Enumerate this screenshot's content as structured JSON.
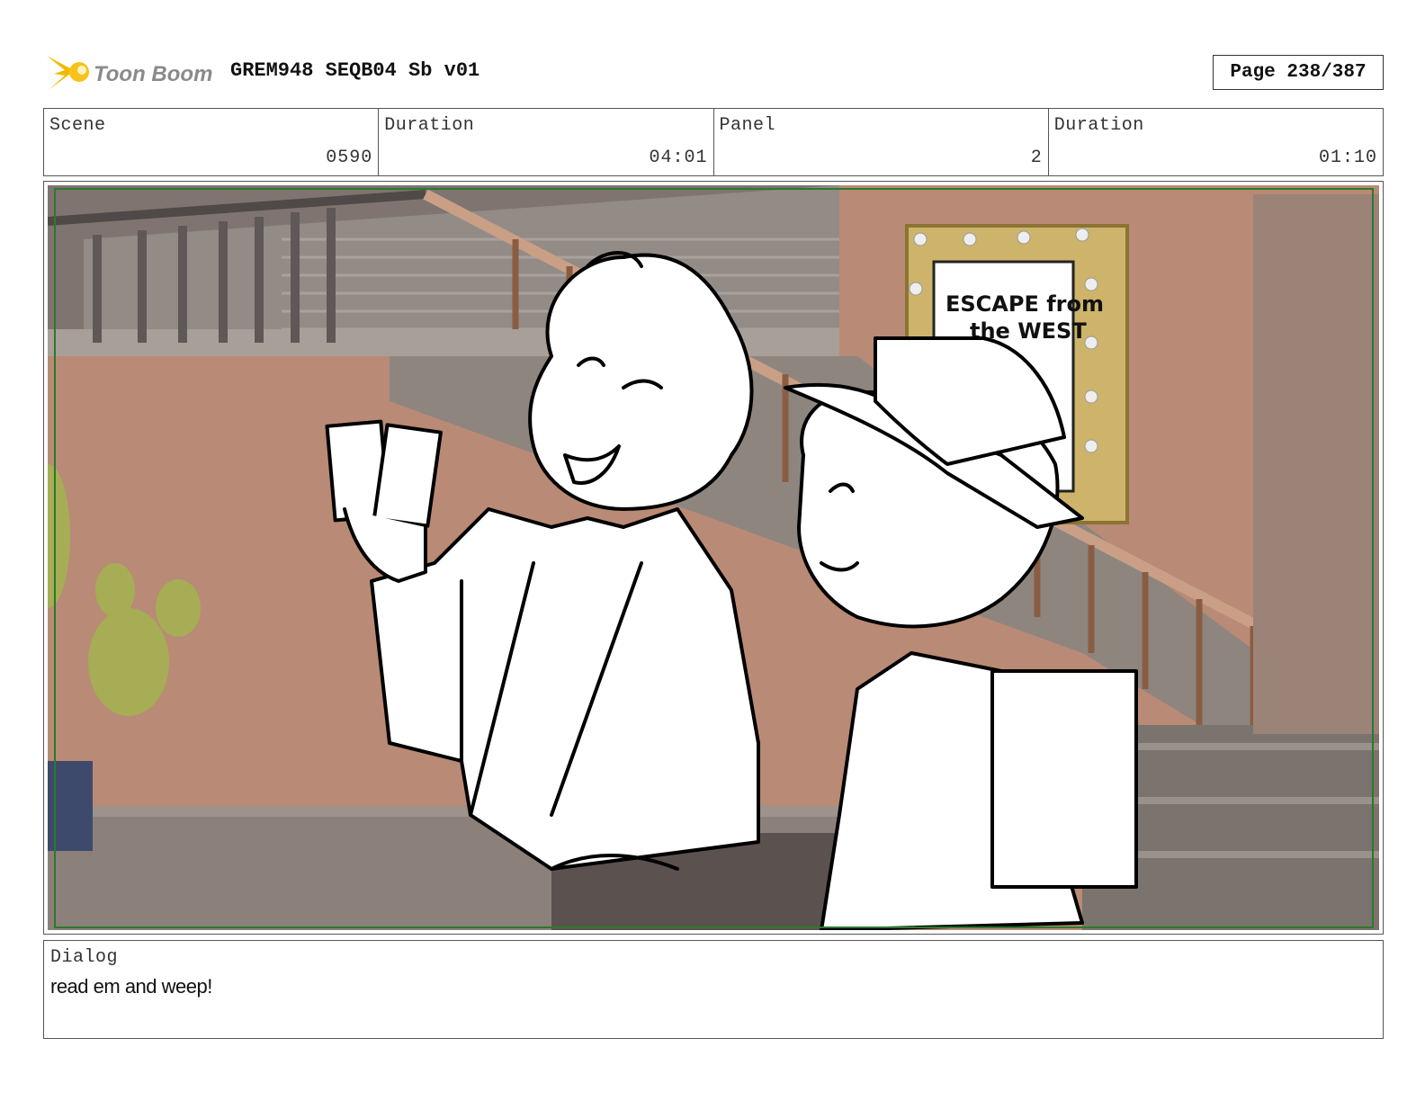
{
  "header": {
    "brand": "Toon Boom",
    "document_title": "GREM948 SEQB04 Sb v01",
    "page_label": "Page 238/387"
  },
  "info": {
    "scene_label": "Scene",
    "scene_value": "0590",
    "scene_duration_label": "Duration",
    "scene_duration_value": "04:01",
    "panel_label": "Panel",
    "panel_value": "2",
    "panel_duration_label": "Duration",
    "panel_duration_value": "01:10"
  },
  "panel": {
    "poster_line1": "ESCAPE from",
    "poster_line2": "the WEST",
    "colors": {
      "wall": "#b5836e",
      "stairs": "#8f8680",
      "railing": "#c79a7e",
      "safe_frame": "#2b7a2b",
      "cactus": "#a6ad55"
    }
  },
  "dialog": {
    "label": "Dialog",
    "text": "read em and weep!"
  }
}
